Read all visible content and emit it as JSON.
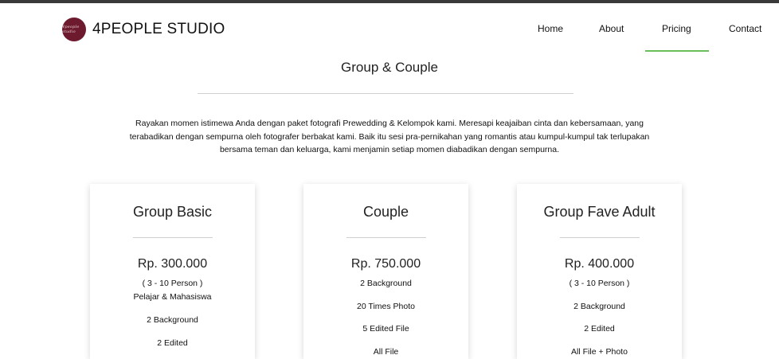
{
  "brand": {
    "name": "4PEOPLE STUDIO",
    "logo_text": "4people studio"
  },
  "nav": {
    "items": [
      {
        "label": "Home"
      },
      {
        "label": "About"
      },
      {
        "label": "Pricing"
      },
      {
        "label": "Contact"
      }
    ],
    "active": "Pricing",
    "accent_color": "#6abf5b"
  },
  "section": {
    "title": "Group & Couple",
    "intro_lines": [
      "Rayakan momen istimewa Anda dengan paket fotografi Prewedding & Kelompok kami. Meresapi keajaiban cinta dan kebersamaan, yang",
      "terabadikan dengan sempurna oleh fotografer berbakat kami. Baik itu sesi pra-pernikahan yang romantis atau kumpul-kumpul tak terlupakan",
      "bersama teman dan keluarga, kami menjamin setiap momen diabadikan dengan sempurna."
    ]
  },
  "packages": [
    {
      "name": "Group Basic",
      "price": "Rp. 300.000",
      "features": [
        "( 3 - 10 Person )",
        "Pelajar & Mahasiswa",
        "2 Background",
        "2 Edited"
      ]
    },
    {
      "name": "Couple",
      "price": "Rp. 750.000",
      "features": [
        "2 Background",
        "20 Times Photo",
        "5 Edited File",
        "All File"
      ]
    },
    {
      "name": "Group Fave Adult",
      "price": "Rp. 400.000",
      "features": [
        "( 3 - 10 Person )",
        "2 Background",
        "2 Edited",
        "All File + Photo"
      ]
    }
  ]
}
